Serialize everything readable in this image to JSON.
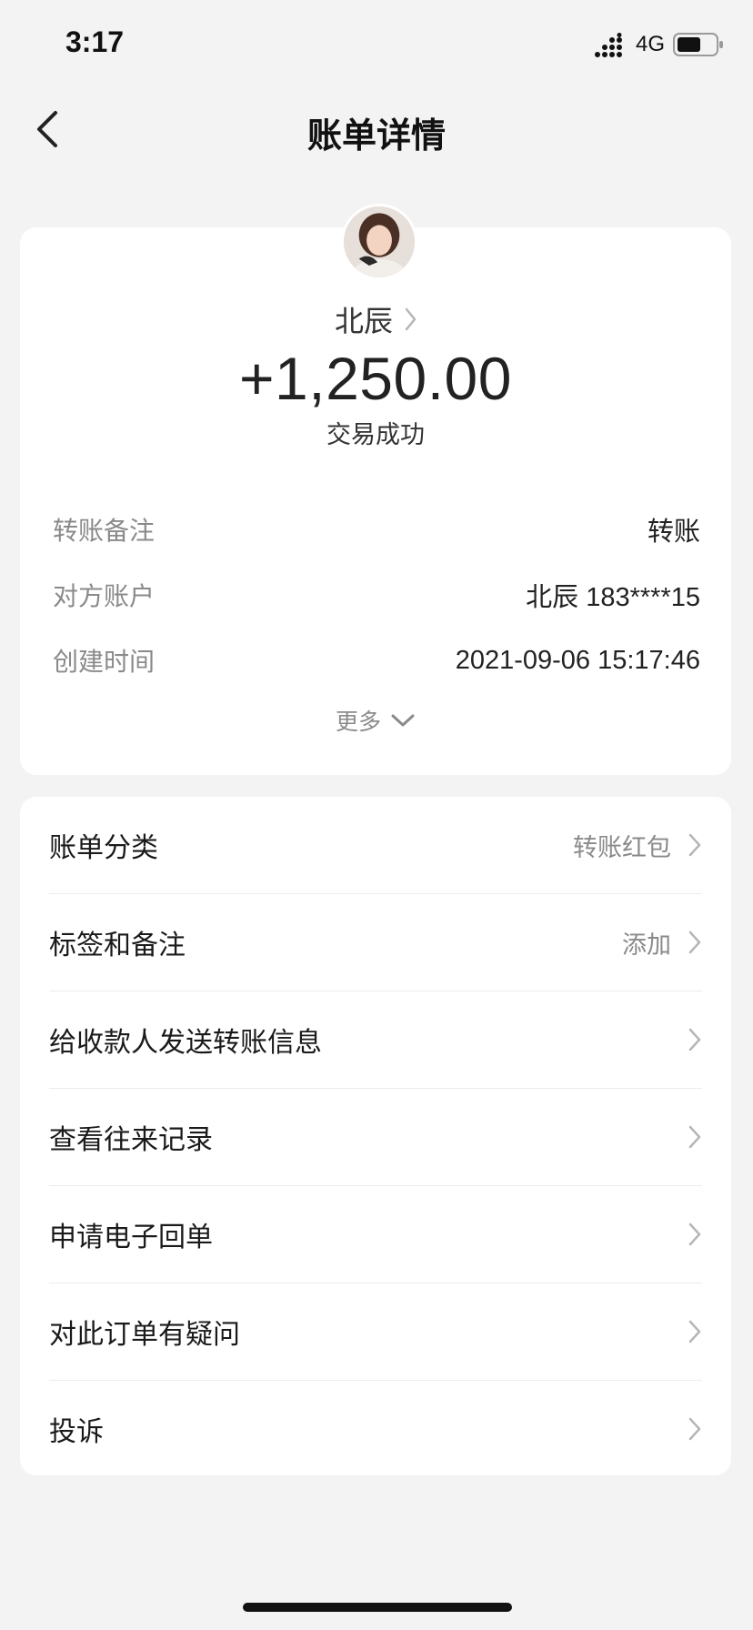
{
  "status_bar": {
    "time": "3:17",
    "network": "4G"
  },
  "nav": {
    "title": "账单详情"
  },
  "summary": {
    "payer_name": "北辰",
    "amount": "+1,250.00",
    "status": "交易成功",
    "details": [
      {
        "label": "转账备注",
        "value": "转账"
      },
      {
        "label": "对方账户",
        "value": "北辰 183****15"
      },
      {
        "label": "创建时间",
        "value": "2021-09-06 15:17:46"
      }
    ],
    "more_label": "更多"
  },
  "menu": [
    {
      "label": "账单分类",
      "value": "转账红包"
    },
    {
      "label": "标签和备注",
      "value": "添加"
    },
    {
      "label": "给收款人发送转账信息",
      "value": ""
    },
    {
      "label": "查看往来记录",
      "value": ""
    },
    {
      "label": "申请电子回单",
      "value": ""
    },
    {
      "label": "对此订单有疑问",
      "value": ""
    },
    {
      "label": "投诉",
      "value": ""
    }
  ],
  "colors": {
    "background": "#f3f3f3",
    "card": "#ffffff",
    "text_primary": "#1a1a1a",
    "text_secondary": "#8a8a8a",
    "chevron": "#b5b5b5"
  },
  "icons": {
    "back": "chevron-left-icon",
    "payer_link": "chevron-right-icon",
    "more": "chevron-down-icon",
    "menu": "chevron-right-icon",
    "signal": "signal-icon",
    "battery": "battery-icon"
  }
}
